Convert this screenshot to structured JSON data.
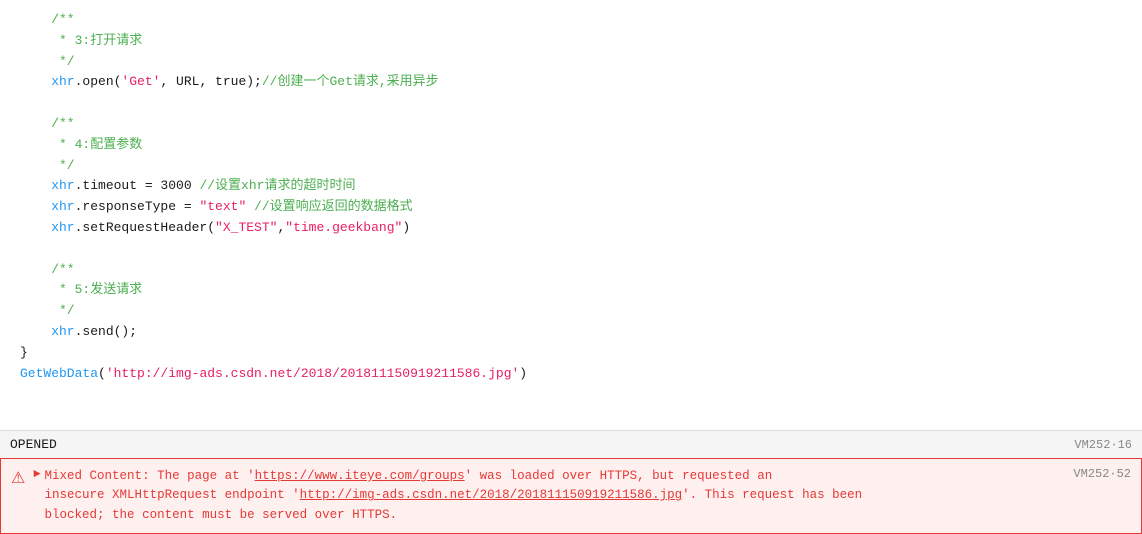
{
  "code": {
    "lines": [
      {
        "indent": "base",
        "content": [
          {
            "t": "comment",
            "v": "/**"
          }
        ]
      },
      {
        "indent": "base",
        "content": [
          {
            "t": "comment",
            "v": " * 3:打开请求"
          }
        ]
      },
      {
        "indent": "base",
        "content": [
          {
            "t": "comment",
            "v": " */"
          }
        ]
      },
      {
        "indent": "base",
        "content": [
          {
            "t": "property",
            "v": "xhr"
          },
          {
            "t": "default",
            "v": ".open("
          },
          {
            "t": "string",
            "v": "'Get'"
          },
          {
            "t": "default",
            "v": ", URL, true);"
          },
          {
            "t": "comment",
            "v": "//创建一个Get请求,采用异步"
          }
        ]
      },
      {
        "indent": "blank",
        "content": []
      },
      {
        "indent": "base",
        "content": [
          {
            "t": "comment",
            "v": "/**"
          }
        ]
      },
      {
        "indent": "base",
        "content": [
          {
            "t": "comment",
            "v": " * 4:配置参数"
          }
        ]
      },
      {
        "indent": "base",
        "content": [
          {
            "t": "comment",
            "v": " */"
          }
        ]
      },
      {
        "indent": "base",
        "content": [
          {
            "t": "property",
            "v": "xhr"
          },
          {
            "t": "default",
            "v": ".timeout = 3000 "
          },
          {
            "t": "comment",
            "v": "//设置xhr请求的超时时间"
          }
        ]
      },
      {
        "indent": "base",
        "content": [
          {
            "t": "property",
            "v": "xhr"
          },
          {
            "t": "default",
            "v": ".responseType = "
          },
          {
            "t": "string",
            "v": "\"text\""
          },
          {
            "t": "default",
            "v": " "
          },
          {
            "t": "comment",
            "v": "//设置响应返回的数据格式"
          }
        ]
      },
      {
        "indent": "base",
        "content": [
          {
            "t": "property",
            "v": "xhr"
          },
          {
            "t": "default",
            "v": ".setRequestHeader("
          },
          {
            "t": "string",
            "v": "\"X_TEST\""
          },
          {
            "t": "default",
            "v": ","
          },
          {
            "t": "string",
            "v": "\"time.geekbang\""
          },
          {
            "t": "default",
            "v": ")"
          }
        ]
      },
      {
        "indent": "blank",
        "content": []
      },
      {
        "indent": "base",
        "content": [
          {
            "t": "comment",
            "v": "/**"
          }
        ]
      },
      {
        "indent": "base",
        "content": [
          {
            "t": "comment",
            "v": " * 5:发送请求"
          }
        ]
      },
      {
        "indent": "base",
        "content": [
          {
            "t": "comment",
            "v": " */"
          }
        ]
      },
      {
        "indent": "base",
        "content": [
          {
            "t": "property",
            "v": "xhr"
          },
          {
            "t": "default",
            "v": ".send();"
          }
        ]
      },
      {
        "indent": "base",
        "content": [
          {
            "t": "default",
            "v": "}"
          }
        ]
      },
      {
        "indent": "base",
        "content": [
          {
            "t": "method",
            "v": "GetWebData"
          },
          {
            "t": "default",
            "v": "("
          },
          {
            "t": "url",
            "v": "'http://img-ads.csdn.net/2018/201811150919211586.jpg'"
          },
          {
            "t": "default",
            "v": ")"
          }
        ]
      }
    ],
    "status_text": "OPENED",
    "vm_badge1": "VM252·16"
  },
  "error": {
    "vm_badge": "VM252·52",
    "line1": "Mixed Content: The page at 'https://www.iteye.com/groups' was loaded over HTTPS, but requested an",
    "link1": "https://www.iteye.com/groups",
    "line2_prefix": "insecure XMLHttpRequest endpoint '",
    "link2": "http://img-ads.csdn.net/2018/201811150919211586.jpg",
    "line2_suffix": "'. This request has been",
    "line3": "blocked; the content must be served over HTTPS."
  }
}
